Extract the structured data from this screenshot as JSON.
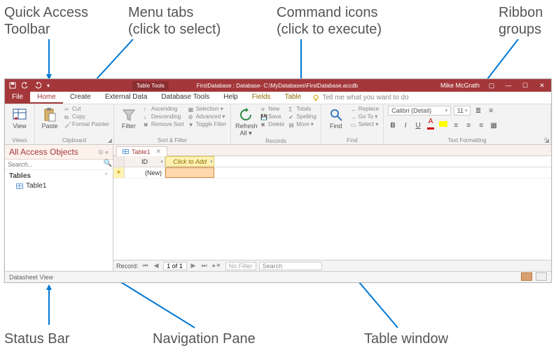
{
  "callouts": {
    "qat": "Quick Access\nToolbar",
    "menu_tabs": "Menu tabs\n(click to select)",
    "command_icons": "Command icons\n(click to execute)",
    "ribbon_groups": "Ribbon\ngroups",
    "status_bar": "Status Bar",
    "nav_pane": "Navigation Pane",
    "table_window": "Table window"
  },
  "titlebar": {
    "table_tools": "Table Tools",
    "path": "FirstDatabase : Database- C:\\MyDatabases\\FirstDatabase.accdb",
    "user": "Mike McGrath"
  },
  "menu": {
    "file": "File",
    "home": "Home",
    "create": "Create",
    "external_data": "External Data",
    "database_tools": "Database Tools",
    "help": "Help",
    "fields": "Fields",
    "table": "Table",
    "tell_me": "Tell me what you want to do"
  },
  "ribbon": {
    "views": {
      "view": "View",
      "label": "Views"
    },
    "clipboard": {
      "paste": "Paste",
      "cut": "Cut",
      "copy": "Copy",
      "format_painter": "Format Painter",
      "label": "Clipboard"
    },
    "sort_filter": {
      "filter": "Filter",
      "ascending": "Ascending",
      "descending": "Descending",
      "remove_sort": "Remove Sort",
      "selection": "Selection ▾",
      "advanced": "Advanced ▾",
      "toggle_filter": "Toggle Filter",
      "label": "Sort & Filter"
    },
    "records": {
      "refresh_all": "Refresh\nAll ▾",
      "new": "New",
      "save": "Save",
      "delete": "Delete",
      "totals": "Totals",
      "spelling": "Spelling",
      "more": "More ▾",
      "label": "Records"
    },
    "find": {
      "find": "Find",
      "replace": "Replace",
      "goto": "Go To ▾",
      "select": "Select ▾",
      "label": "Find"
    },
    "text": {
      "font_name": "Calibri (Detail)",
      "font_size": "11",
      "label": "Text Formatting"
    }
  },
  "nav": {
    "header": "All Access Objects",
    "search_placeholder": "Search...",
    "tables_section": "Tables",
    "table1": "Table1"
  },
  "doc": {
    "tab": "Table1",
    "col_id": "ID",
    "col_add": "Click to Add",
    "new_row": "(New)"
  },
  "recordbar": {
    "label": "Record:",
    "pos": "1 of 1",
    "nofilter": "No Filter",
    "search": "Search"
  },
  "statusbar": {
    "left": "Datasheet View"
  }
}
